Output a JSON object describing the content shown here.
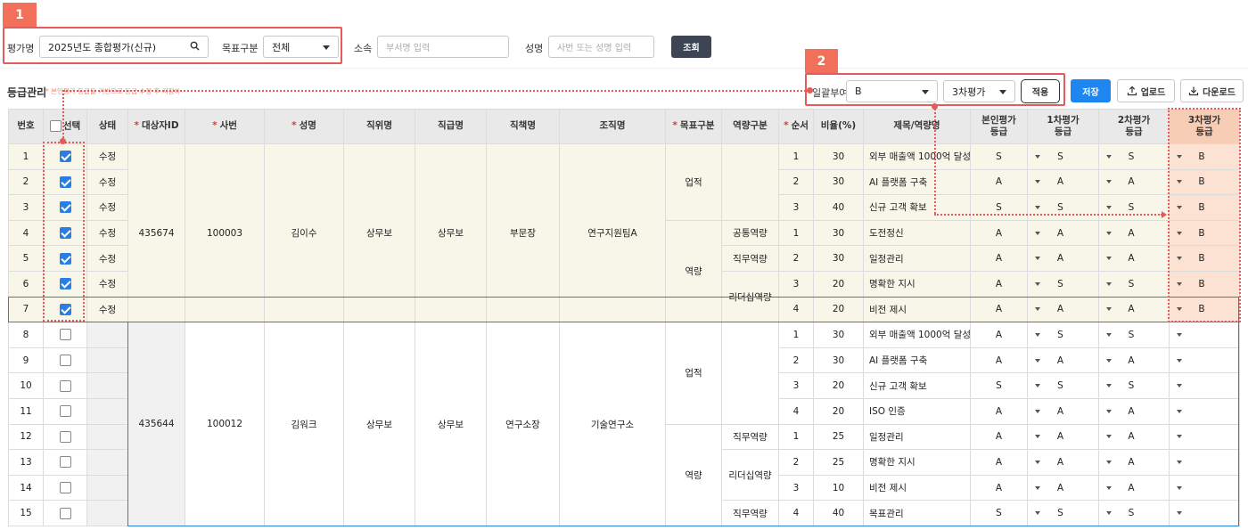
{
  "filters": {
    "eval_label": "평가명",
    "eval_value": "2025년도 종합평가(신규)",
    "target_label": "목표구분",
    "target_value": "전체",
    "dept_label": "소속",
    "dept_placeholder": "부서명 입력",
    "name_label": "성명",
    "name_placeholder": "사번 또는 성명 입력",
    "search_button": "조회"
  },
  "section": {
    "title": "등급관리",
    "note": "* 본인평가 등급을 기반으로 등급 수정 후 저장하세요"
  },
  "bulk": {
    "label": "일괄부여",
    "grade_value": "B",
    "round_value": "3차평가",
    "apply_button": "적용",
    "save_button": "저장",
    "upload_button": "업로드",
    "download_button": "다운로드"
  },
  "callouts": [
    "1",
    "2"
  ],
  "columns": [
    "번호",
    "선택",
    "상태",
    "대상자ID",
    "사번",
    "성명",
    "직위명",
    "직급명",
    "직책명",
    "조직명",
    "목표구분",
    "역량구분",
    "순서",
    "비율(%)",
    "제목/역량명",
    "본인평가\n등급",
    "1차평가\n등급",
    "2차평가\n등급",
    "3차평가\n등급"
  ],
  "groups": [
    {
      "target_id": "435674",
      "emp_no": "100003",
      "name": "김이수",
      "position": "상무보",
      "rank": "상무보",
      "title": "부문장",
      "org": "연구지원팀A"
    },
    {
      "target_id": "435644",
      "emp_no": "100012",
      "name": "김워크",
      "position": "상무보",
      "rank": "상무보",
      "title": "연구소장",
      "org": "기술연구소"
    }
  ],
  "rows": [
    {
      "no": "1",
      "checked": true,
      "status": "수정",
      "order": "1",
      "ratio": "30",
      "item": "외부 매출액 1000억 달성",
      "self": "S",
      "g1": "S",
      "g2": "S",
      "g3": "B"
    },
    {
      "no": "2",
      "checked": true,
      "status": "수정",
      "order": "2",
      "ratio": "30",
      "item": "AI 플랫폼 구축",
      "self": "A",
      "g1": "A",
      "g2": "A",
      "g3": "B"
    },
    {
      "no": "3",
      "checked": true,
      "status": "수정",
      "order": "3",
      "ratio": "40",
      "item": "신규 고객 확보",
      "self": "S",
      "g1": "S",
      "g2": "S",
      "g3": "B"
    },
    {
      "no": "4",
      "checked": true,
      "status": "수정",
      "order": "1",
      "ratio": "30",
      "item": "도전정신",
      "self": "A",
      "g1": "A",
      "g2": "A",
      "g3": "B"
    },
    {
      "no": "5",
      "checked": true,
      "status": "수정",
      "order": "2",
      "ratio": "30",
      "item": "일정관리",
      "self": "A",
      "g1": "A",
      "g2": "A",
      "g3": "B"
    },
    {
      "no": "6",
      "checked": true,
      "status": "수정",
      "order": "3",
      "ratio": "20",
      "item": "명확한 지시",
      "self": "A",
      "g1": "S",
      "g2": "S",
      "g3": "B"
    },
    {
      "no": "7",
      "checked": true,
      "status": "수정",
      "order": "4",
      "ratio": "20",
      "item": "비전 제시",
      "self": "A",
      "g1": "A",
      "g2": "A",
      "g3": "B"
    },
    {
      "no": "8",
      "checked": false,
      "status": "",
      "order": "1",
      "ratio": "30",
      "item": "외부 매출액 1000억 달성",
      "self": "A",
      "g1": "S",
      "g2": "S",
      "g3": ""
    },
    {
      "no": "9",
      "checked": false,
      "status": "",
      "order": "2",
      "ratio": "30",
      "item": "AI 플랫폼 구축",
      "self": "A",
      "g1": "A",
      "g2": "A",
      "g3": ""
    },
    {
      "no": "10",
      "checked": false,
      "status": "",
      "order": "3",
      "ratio": "20",
      "item": "신규 고객 확보",
      "self": "S",
      "g1": "S",
      "g2": "S",
      "g3": ""
    },
    {
      "no": "11",
      "checked": false,
      "status": "",
      "order": "4",
      "ratio": "20",
      "item": "ISO 인증",
      "self": "A",
      "g1": "A",
      "g2": "A",
      "g3": ""
    },
    {
      "no": "12",
      "checked": false,
      "status": "",
      "order": "1",
      "ratio": "25",
      "item": "일정관리",
      "self": "A",
      "g1": "A",
      "g2": "A",
      "g3": ""
    },
    {
      "no": "13",
      "checked": false,
      "status": "",
      "order": "2",
      "ratio": "25",
      "item": "명확한 지시",
      "self": "A",
      "g1": "A",
      "g2": "A",
      "g3": ""
    },
    {
      "no": "14",
      "checked": false,
      "status": "",
      "order": "3",
      "ratio": "10",
      "item": "비전 제시",
      "self": "A",
      "g1": "A",
      "g2": "A",
      "g3": ""
    },
    {
      "no": "15",
      "checked": false,
      "status": "",
      "order": "4",
      "ratio": "40",
      "item": "목표관리",
      "self": "S",
      "g1": "S",
      "g2": "S",
      "g3": ""
    }
  ],
  "goal_types": {
    "perf": "업적",
    "comp": "역량"
  },
  "comp_types": {
    "common": "공통역량",
    "job": "직무역량",
    "lead": "리더십역량"
  },
  "colors": {
    "accent": "#1e86f0",
    "callout": "#e35b5b",
    "highlight": "#f7cdb6"
  }
}
